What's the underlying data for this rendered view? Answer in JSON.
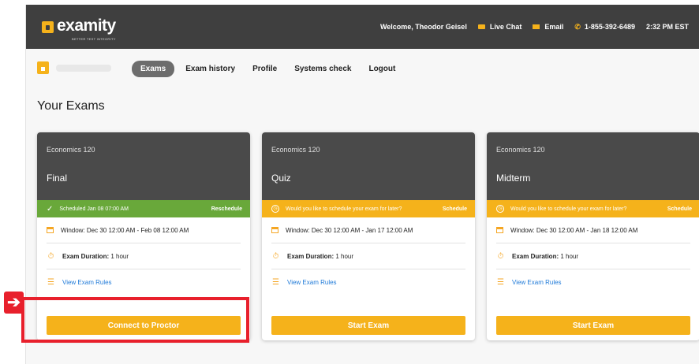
{
  "brand": {
    "name": "examity",
    "tagline": "BETTER TEST INTEGRITY",
    "accent": "#f5b21b",
    "dark": "#3f3f3f"
  },
  "topbar": {
    "welcome": "Welcome, Theodor Geisel",
    "live_chat": "Live Chat",
    "email": "Email",
    "phone": "1-855-392-6489",
    "time": "2:32 PM EST"
  },
  "nav": {
    "items": [
      {
        "label": "Exams",
        "active": true
      },
      {
        "label": "Exam history"
      },
      {
        "label": "Profile"
      },
      {
        "label": "Systems check"
      },
      {
        "label": "Logout"
      }
    ]
  },
  "page": {
    "title": "Your Exams"
  },
  "cards": [
    {
      "course": "Economics 120",
      "name": "Final",
      "status": {
        "type": "scheduled",
        "color": "#69a83a",
        "text": "Scheduled Jan 08 07:00 AM",
        "action": "Reschedule"
      },
      "window": "Window: Dec 30 12:00 AM - Feb 08 12:00 AM",
      "duration_label": "Exam Duration:",
      "duration": "1 hour",
      "rules_link": "View Exam Rules",
      "button": "Connect to Proctor"
    },
    {
      "course": "Economics 120",
      "name": "Quiz",
      "status": {
        "type": "prompt",
        "color": "#f5b21b",
        "text": "Would you like to schedule your exam for later?",
        "action": "Schedule"
      },
      "window": "Window: Dec 30 12:00 AM - Jan 17 12:00 AM",
      "duration_label": "Exam Duration:",
      "duration": "1 hour",
      "rules_link": "View Exam Rules",
      "button": "Start Exam"
    },
    {
      "course": "Economics 120",
      "name": "Midterm",
      "status": {
        "type": "prompt",
        "color": "#f5b21b",
        "text": "Would you like to schedule your exam for later?",
        "action": "Schedule"
      },
      "window": "Window: Dec 30 12:00 AM - Jan 18 12:00 AM",
      "duration_label": "Exam Duration:",
      "duration": "1 hour",
      "rules_link": "View Exam Rules",
      "button": "Start Exam"
    }
  ],
  "annotation": {
    "color": "#e8202c"
  }
}
